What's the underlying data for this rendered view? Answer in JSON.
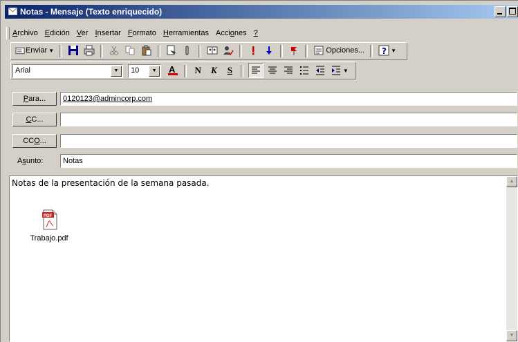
{
  "window": {
    "title": "Notas - Mensaje (Texto enriquecido)",
    "titlebar_color": "#0a246a"
  },
  "menu": [
    {
      "label": "Archivo",
      "ul": "A"
    },
    {
      "label": "Edición",
      "ul": "E"
    },
    {
      "label": "Ver",
      "ul": "V"
    },
    {
      "label": "Insertar",
      "ul": "I"
    },
    {
      "label": "Formato",
      "ul": "F"
    },
    {
      "label": "Herramientas",
      "ul": "H"
    },
    {
      "label": "Acciones",
      "ul": "o"
    },
    {
      "label": "?",
      "ul": "?"
    }
  ],
  "toolbar1": {
    "send_label": "Enviar",
    "options_label": "Opciones...",
    "icons": [
      "send-icon",
      "save-icon",
      "print-icon",
      "cut-icon",
      "copy-icon",
      "paste-icon",
      "insert-file-icon",
      "attach-icon",
      "address-book-icon",
      "check-names-icon",
      "high-importance-icon",
      "low-importance-icon",
      "flag-icon",
      "options-icon",
      "help-icon"
    ]
  },
  "toolbar2": {
    "font_name": "Arial",
    "font_size": "10",
    "bold_label": "N",
    "italic_label": "K",
    "underline_label": "S",
    "font_color": "#cc0000"
  },
  "fields": {
    "to_button": "Para...",
    "to_value": "0120123@admincorp.com",
    "cc_button": "CC...",
    "cc_value": "",
    "bcc_button": "CCO...",
    "bcc_value": "",
    "subject_label": "Asunto:",
    "subject_value": "Notas"
  },
  "message": {
    "body_text": "Notas de la presentación de la semana pasada.",
    "attachment_name": "Trabajo.pdf",
    "attachment_badge": "PDF"
  }
}
